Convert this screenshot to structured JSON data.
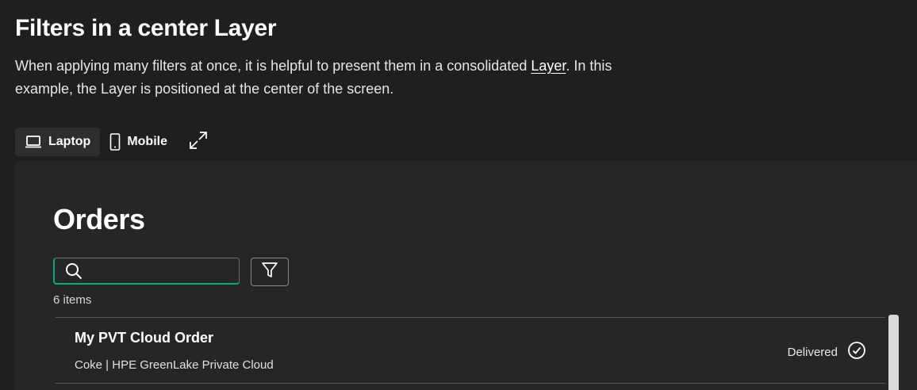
{
  "header": {
    "title": "Filters in a center Layer",
    "description_pre": "When applying many filters at once, it is helpful to present them in a consolidated ",
    "description_link": "Layer",
    "description_post": ". In this example, the Layer is positioned at the center of the screen."
  },
  "tabs": [
    {
      "label": "Laptop",
      "icon": "laptop-icon",
      "active": true
    },
    {
      "label": "Mobile",
      "icon": "mobile-icon",
      "active": false
    }
  ],
  "preview": {
    "title": "Orders",
    "search": {
      "value": "",
      "placeholder": ""
    },
    "count_text": "6 items",
    "orders": [
      {
        "title": "My PVT Cloud Order",
        "subtitle": "Coke | HPE GreenLake Private Cloud",
        "status": "Delivered",
        "status_icon": "status-good-icon"
      }
    ]
  },
  "colors": {
    "background": "#1f1f1f",
    "preview_background": "#262626",
    "accent": "#01a982"
  }
}
